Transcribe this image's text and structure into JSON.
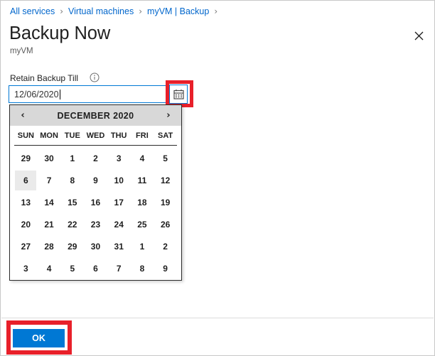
{
  "breadcrumb": {
    "separator": "›",
    "items": [
      {
        "label": "All services"
      },
      {
        "label": "Virtual machines"
      },
      {
        "label": "myVM | Backup"
      }
    ]
  },
  "header": {
    "title": "Backup Now",
    "subtitle": "myVM",
    "close_icon": "close-icon"
  },
  "field": {
    "label": "Retain Backup Till",
    "info_icon": "info-icon",
    "value": "12/06/2020",
    "calendar_icon": "calendar-icon"
  },
  "calendar": {
    "prev_label": "‹",
    "next_label": "›",
    "month_year": "DECEMBER 2020",
    "day_headers": [
      "SUN",
      "MON",
      "TUE",
      "WED",
      "THU",
      "FRI",
      "SAT"
    ],
    "weeks": [
      [
        "29",
        "30",
        "1",
        "2",
        "3",
        "4",
        "5"
      ],
      [
        "6",
        "7",
        "8",
        "9",
        "10",
        "11",
        "12"
      ],
      [
        "13",
        "14",
        "15",
        "16",
        "17",
        "18",
        "19"
      ],
      [
        "20",
        "21",
        "22",
        "23",
        "24",
        "25",
        "26"
      ],
      [
        "27",
        "28",
        "29",
        "30",
        "31",
        "1",
        "2"
      ],
      [
        "3",
        "4",
        "5",
        "6",
        "7",
        "8",
        "9"
      ]
    ],
    "selected": {
      "week": 1,
      "day": 0,
      "value": "6"
    }
  },
  "footer": {
    "ok_label": "OK"
  },
  "annotations": {
    "highlight_color": "#e8202a",
    "targets": [
      "calendar-icon-button",
      "ok-button"
    ]
  },
  "colors": {
    "link": "#0066cc",
    "accent": "#0078d4",
    "calendar_header_bg": "#d8d8d8",
    "selected_day_bg": "#eaeaea"
  }
}
